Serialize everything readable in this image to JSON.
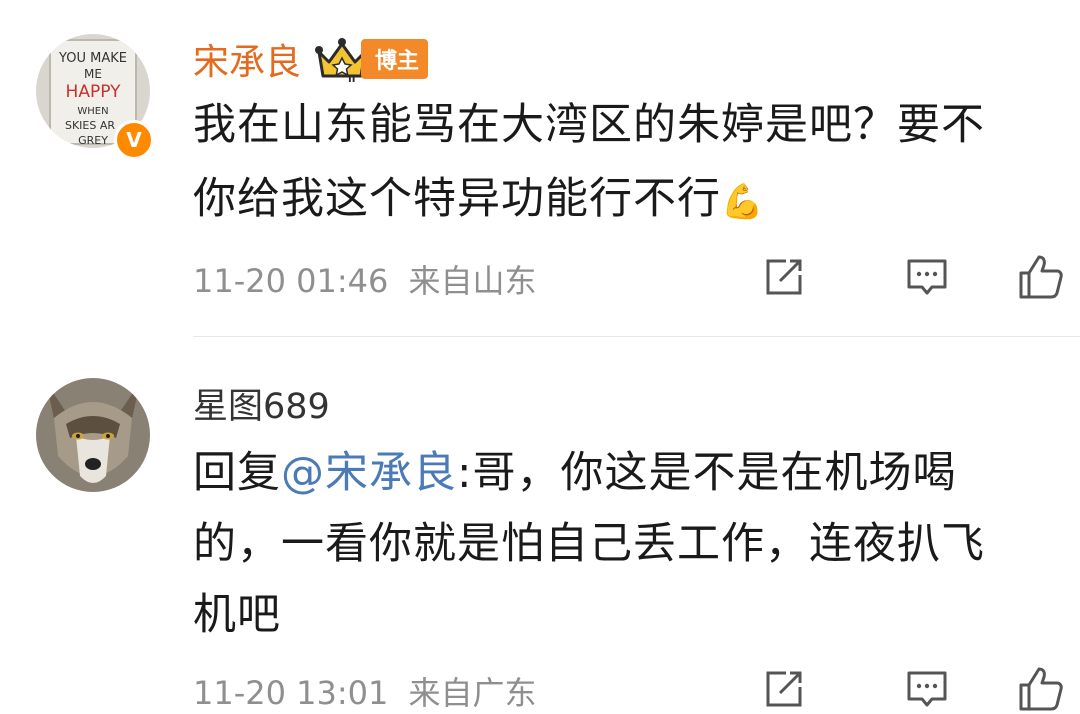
{
  "comments": [
    {
      "username": "宋承良",
      "role_tag": "博主",
      "verified_mark": "V",
      "avatar_sign": [
        "YOU MAKE",
        "ME",
        "HAPPY",
        "WHEN",
        "SKIES AR",
        "GREY"
      ],
      "text": "我在山东能骂在大湾区的朱婷是吧？要不你给我这个特异功能行不行",
      "emoji": "💪",
      "timestamp": "11-20 01:46",
      "location": "来自山东"
    },
    {
      "username": "星图689",
      "reply_prefix": "回复",
      "reply_mention": "@宋承良",
      "text": ":哥，你这是不是在机场喝的，一看你就是怕自己丢工作，连夜扒飞机吧",
      "timestamp": "11-20 13:01",
      "location": "来自广东"
    }
  ],
  "icons": [
    "share-icon",
    "comment-icon",
    "like-icon"
  ],
  "colors": {
    "username_accent": "#e46a1d",
    "mention": "#4b7ab8",
    "meta": "#8f8f8f",
    "role_tag": "#f4892a"
  }
}
